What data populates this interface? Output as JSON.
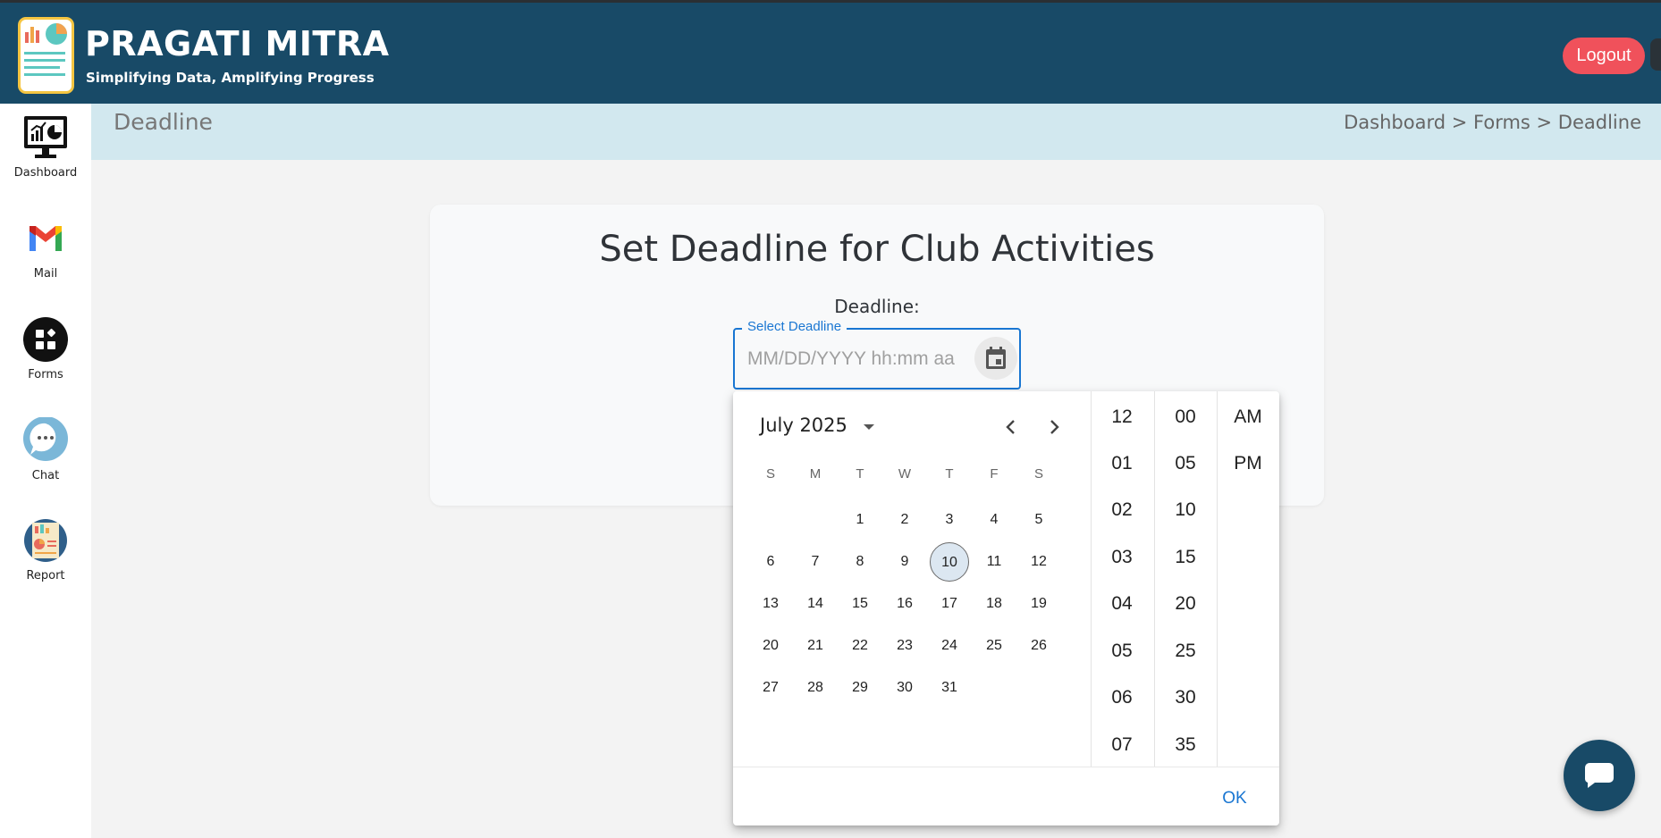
{
  "header": {
    "brand_title": "PRAGATI MITRA",
    "brand_subtitle": "Simplifying Data, Amplifying Progress",
    "logout_label": "Logout"
  },
  "sidebar": {
    "items": [
      {
        "label": "Dashboard",
        "icon": "monitor-chart-icon"
      },
      {
        "label": "Mail",
        "icon": "gmail-icon"
      },
      {
        "label": "Forms",
        "icon": "forms-icon"
      },
      {
        "label": "Chat",
        "icon": "chat-bubble-icon"
      },
      {
        "label": "Report",
        "icon": "report-icon"
      }
    ]
  },
  "page": {
    "title": "Deadline",
    "breadcrumb": "Dashboard > Forms > Deadline"
  },
  "card": {
    "title": "Set Deadline for Club Activities",
    "deadline_label": "Deadline:",
    "field_legend": "Select Deadline",
    "field_placeholder": "MM/DD/YYYY hh:mm aa",
    "field_value": ""
  },
  "picker": {
    "month_label": "July 2025",
    "weekdays": [
      "S",
      "M",
      "T",
      "W",
      "T",
      "F",
      "S"
    ],
    "first_weekday_index": 2,
    "days_in_month": 31,
    "today": 10,
    "hours": [
      "12",
      "01",
      "02",
      "03",
      "04",
      "05",
      "06",
      "07"
    ],
    "minutes": [
      "00",
      "05",
      "10",
      "15",
      "20",
      "25",
      "30",
      "35"
    ],
    "meridiem": [
      "AM",
      "PM"
    ],
    "ok_label": "OK"
  },
  "colors": {
    "header_bg": "#184a67",
    "logout_bg": "#f0515b",
    "accent": "#1976d2",
    "page_strip_bg": "#d2e8ef"
  }
}
